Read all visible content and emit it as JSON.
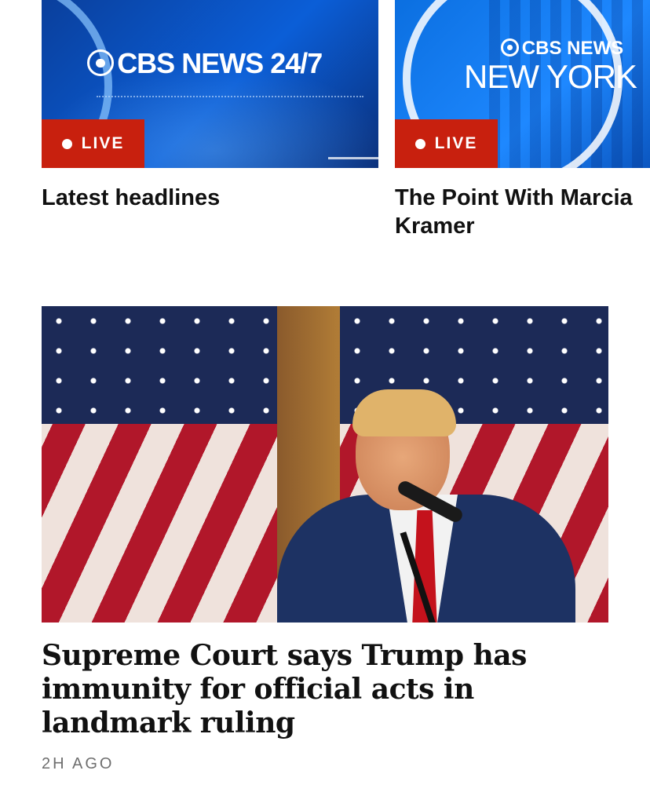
{
  "live_cards": [
    {
      "brand_line1": "CBS NEWS 24/7",
      "badge": "LIVE",
      "title": "Latest headlines"
    },
    {
      "brand_line1": "CBS NEWS",
      "brand_line2": "NEW YORK",
      "badge": "LIVE",
      "title": "The Point With Marcia Kramer"
    }
  ],
  "story": {
    "headline": "Supreme Court says Trump has immunity for official acts in landmark ruling",
    "timestamp": "2H AGO"
  },
  "colors": {
    "live_badge": "#c8200e",
    "card_blue_1": "#0b5ed7",
    "card_blue_2": "#1e88ff",
    "timestamp_gray": "#6f6f6f"
  },
  "icons": [
    "cbs-eye-icon",
    "live-dot-icon"
  ]
}
